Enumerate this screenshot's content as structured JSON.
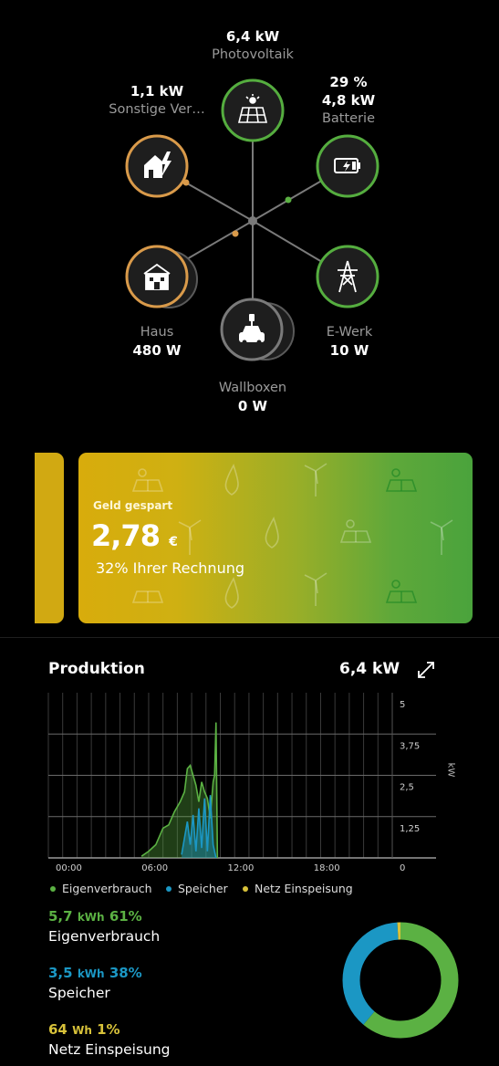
{
  "nodes": {
    "photovoltaik": {
      "value": "6,4  kW",
      "name": "Photovoltaik"
    },
    "batterie": {
      "percent": "29 %",
      "value": "4,8  kW",
      "name": "Batterie"
    },
    "sonstige": {
      "value": "1,1  kW",
      "name": "Sonstige Ver…"
    },
    "haus": {
      "value": "480  W",
      "name": "Haus"
    },
    "ewerk": {
      "value": "10  W",
      "name": "E-Werk"
    },
    "wallboxen": {
      "value": "0  W",
      "name": "Wallboxen"
    }
  },
  "savings": {
    "title": "Geld gespart",
    "amount": "2,78",
    "currency": "€",
    "subtitle": "32% Ihrer Rechnung"
  },
  "production": {
    "title": "Produktion",
    "value": "6,4  kW",
    "unit_axis": "kW",
    "legend": [
      {
        "label": "Eigenverbrauch",
        "color": "#5bb143"
      },
      {
        "label": "Speicher",
        "color": "#1b97c4"
      },
      {
        "label": "Netz Einspeisung",
        "color": "#d8c23a"
      }
    ],
    "stats": [
      {
        "value": "5,7",
        "unit": "kWh",
        "percent": "61%",
        "name": "Eigenverbrauch",
        "color": "#5bb143"
      },
      {
        "value": "3,5",
        "unit": "kWh",
        "percent": "38%",
        "name": "Speicher",
        "color": "#1b97c4"
      },
      {
        "value": "64",
        "unit": "Wh",
        "percent": "1%",
        "name": "Netz Einspeisung",
        "color": "#d8c23a"
      }
    ]
  },
  "chart_data": {
    "type": "area",
    "xlabel": "",
    "ylabel": "kW",
    "x_ticks": [
      "00:00",
      "06:00",
      "12:00",
      "18:00"
    ],
    "y_ticks": [
      "5",
      "3,75",
      "2,5",
      "1,25",
      "0"
    ],
    "ylim": [
      0,
      5
    ],
    "xlim_hours": [
      0,
      24
    ],
    "grid": true,
    "series": [
      {
        "name": "Eigenverbrauch",
        "color": "#5bb143",
        "x_hours": [
          6.5,
          7.0,
          7.5,
          7.8,
          8.0,
          8.4,
          8.8,
          9.2,
          9.5,
          9.7,
          9.9,
          10.1,
          10.3,
          10.5,
          10.7,
          10.9,
          11.1,
          11.3,
          11.5,
          11.6,
          11.7,
          11.8
        ],
        "values": [
          0.05,
          0.2,
          0.4,
          0.7,
          0.9,
          1.0,
          1.4,
          1.7,
          2.0,
          2.7,
          2.8,
          2.5,
          2.2,
          1.7,
          2.3,
          2.0,
          1.8,
          1.2,
          2.3,
          2.5,
          4.1,
          0.0
        ]
      },
      {
        "name": "Speicher",
        "color": "#1b97c4",
        "x_hours": [
          9.3,
          9.5,
          9.7,
          9.9,
          10.1,
          10.3,
          10.5,
          10.7,
          10.9,
          11.1,
          11.3,
          11.5,
          11.7
        ],
        "values": [
          0.1,
          0.6,
          1.1,
          0.4,
          1.3,
          0.2,
          1.5,
          0.3,
          1.8,
          0.2,
          1.9,
          0.4,
          0.0
        ]
      },
      {
        "name": "Netz Einspeisung",
        "color": "#d8c23a",
        "x_hours": [],
        "values": []
      }
    ],
    "donut": [
      {
        "name": "Eigenverbrauch",
        "percent": 61,
        "color": "#5bb143"
      },
      {
        "name": "Speicher",
        "percent": 38,
        "color": "#1b97c4"
      },
      {
        "name": "Netz Einspeisung",
        "percent": 1,
        "color": "#d8c23a"
      }
    ]
  },
  "icons": {
    "photovoltaik": "solar-panel-icon",
    "batterie": "battery-icon",
    "sonstige": "house-lightning-icon",
    "haus": "house-icon",
    "ewerk": "power-tower-icon",
    "wallboxen": "car-charger-icon",
    "expand": "expand-icon"
  }
}
